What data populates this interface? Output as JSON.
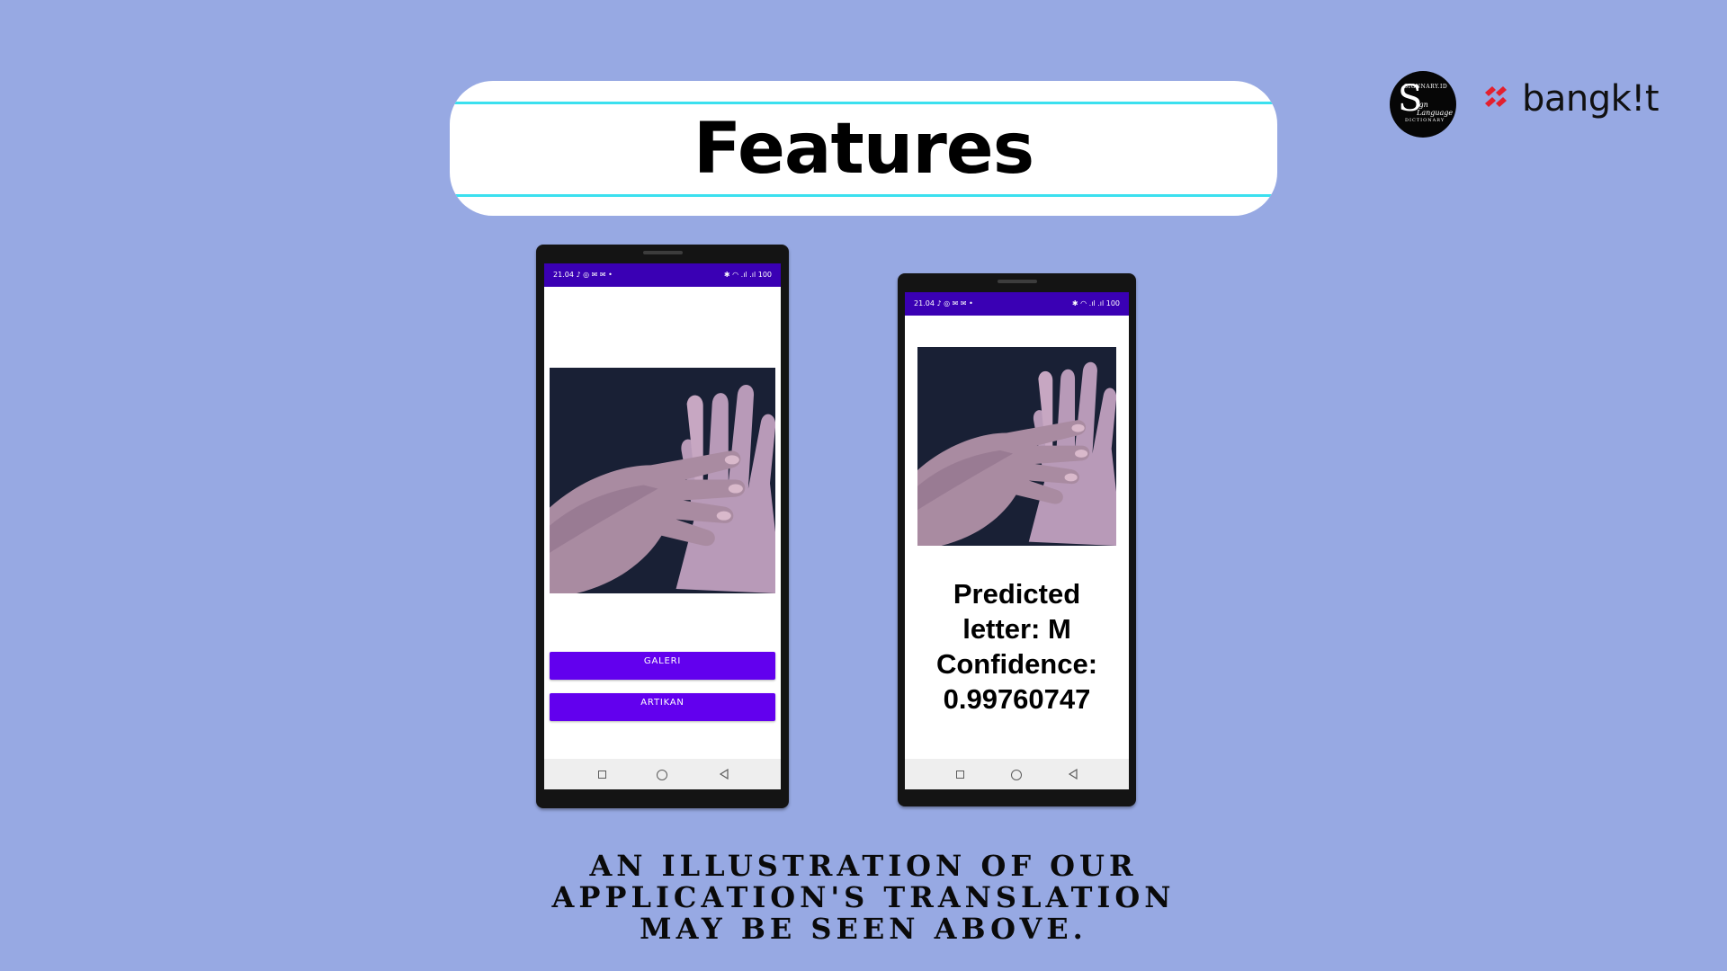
{
  "slide": {
    "title": "Features",
    "caption_lines": [
      "AN ILLUSTRATION OF OUR",
      "APPLICATION'S TRANSLATION",
      "MAY BE SEEN ABOVE."
    ],
    "background_color": "#97a9e3",
    "accent_line_color": "#3be0ef"
  },
  "logos": {
    "sign_dictionary": {
      "top_text": "SIGNNARY.ID",
      "letter": "S",
      "script_text": "ign Language",
      "bottom_text": "DICTIONARY"
    },
    "bangkit": {
      "text": "bangk!t",
      "icon": "bangkit-logo-icon",
      "color": "#e3202e"
    }
  },
  "phone_left": {
    "status_time": "21.04",
    "status_left_icons": "♪ ◎ ✉ ✉ •",
    "status_right_icons": "✱ ◠ .ıl .ıl 100",
    "buttons": [
      {
        "label": "GALERI"
      },
      {
        "label": "ARTIKAN"
      }
    ],
    "app_bar_color": "#3a00b4",
    "button_color": "#6200ee"
  },
  "phone_right": {
    "status_time": "21.04",
    "status_left_icons": "♪ ◎ ✉ ✉ •",
    "status_right_icons": "✱ ◠ .ıl .ıl 100",
    "prediction_lines": [
      "Predicted",
      "letter: M",
      "Confidence:",
      "0.99760747"
    ]
  },
  "navigation_icons": [
    "recent-apps-icon",
    "home-icon",
    "back-icon"
  ]
}
